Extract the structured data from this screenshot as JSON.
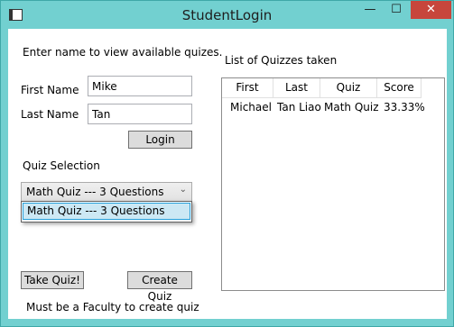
{
  "window": {
    "title": "StudentLogin",
    "minimize_glyph": "—",
    "maximize_glyph": "☐",
    "close_glyph": "✕"
  },
  "login": {
    "instructions": "Enter name to view available quizes.",
    "first_name_label": "First Name",
    "first_name_value": "Mike",
    "last_name_label": "Last Name",
    "last_name_value": "Tan",
    "login_button": "Login"
  },
  "quiz_selection": {
    "label": "Quiz Selection",
    "selected": "Math Quiz --- 3 Questions",
    "options": [
      "Math Quiz --- 3 Questions"
    ]
  },
  "actions": {
    "take_quiz_button": "Take Quiz!",
    "create_quiz_button": "Create Quiz",
    "faculty_note": "Must be a Faculty to create quiz"
  },
  "quizzes_taken": {
    "title": "List of Quizzes taken",
    "columns": [
      "First",
      "Last",
      "Quiz",
      "Score"
    ],
    "rows": [
      [
        "Michael",
        "Tan Liao",
        "Math Quiz",
        "33.33%"
      ]
    ]
  }
}
